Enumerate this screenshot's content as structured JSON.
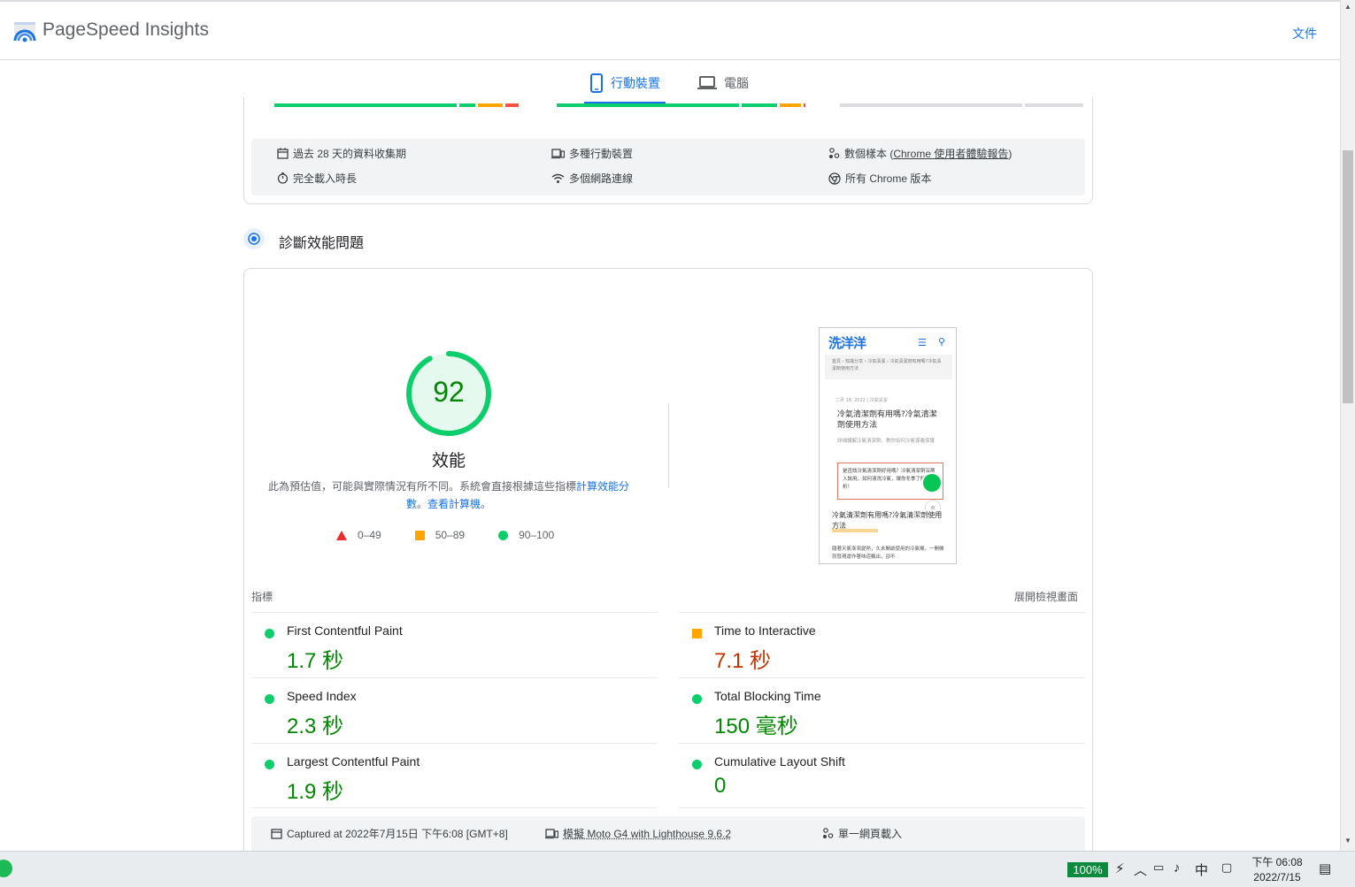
{
  "header": {
    "brand": "PageSpeed Insights",
    "docs_link": "文件"
  },
  "tabs": [
    {
      "label": "行動裝置",
      "active": true
    },
    {
      "label": "電腦",
      "active": false
    }
  ],
  "field_info": {
    "collection_period": "過去 28 天的資料收集期",
    "devices": "多種行動裝置",
    "samples_prefix": "數個樣本 (",
    "samples_link": "Chrome 使用者體驗報告",
    "samples_suffix": ")",
    "full_load": "完全載入時長",
    "network": "多個網路連線",
    "chrome_versions": "所有 Chrome 版本"
  },
  "diagnose": {
    "title": "診斷效能問題"
  },
  "gauge": {
    "score": "92",
    "score_fraction": 0.92,
    "label": "效能"
  },
  "note": {
    "text": "此為預估值，可能與實際情況有所不同。系統會直接根據這些指標",
    "link1": "計算效能分數",
    "sep": "。",
    "link2": "查看計算機",
    "end": "。"
  },
  "legend": {
    "fail": "0–49",
    "average": "50–89",
    "pass": "90–100"
  },
  "phone": {
    "logo": "洗洋洋",
    "breadcrumb": "首頁 › 知識分享 › 冷氣清潔 › 冷氣清潔劑有用嗎?冷氣清潔劑使用方法",
    "date": "二月 18, 2022 | 冷氣清潔",
    "title": "冷氣清潔劑有用嗎?冷氣清潔劑使用方法",
    "subtitle": "詳細講解冷氣清潔劑，教你如何冷氣保養保護",
    "box_text": "是否該冷氣清潔劑好用嗎？冷氣清潔劑深層入該用，如何清洗冷氣，讓你冬季了解分析！",
    "heading2": "冷氣清潔劑有用嗎?冷氣清潔劑使用方法",
    "paragraph": "隨著天氣漸漸變熱，久未開啟使用的冷氣機，一開機就發現運作著味道飄出，卻不"
  },
  "metrics_header": {
    "left": "指標",
    "right": "展開檢視畫面"
  },
  "metrics": [
    {
      "name": "First Contentful Paint",
      "value": "1.7 秒",
      "status": "pass"
    },
    {
      "name": "Time to Interactive",
      "value": "7.1 秒",
      "status": "average"
    },
    {
      "name": "Speed Index",
      "value": "2.3 秒",
      "status": "pass"
    },
    {
      "name": "Total Blocking Time",
      "value": "150 毫秒",
      "status": "pass"
    },
    {
      "name": "Largest Contentful Paint",
      "value": "1.9 秒",
      "status": "pass"
    },
    {
      "name": "Cumulative Layout Shift",
      "value": "0",
      "status": "pass"
    }
  ],
  "run_info": {
    "captured": "Captured at 2022年7月15日 下午6:08 [GMT+8]",
    "device": "模擬 Moto G4 with Lighthouse 9.6.2",
    "load": "單一網頁載入"
  },
  "taskbar": {
    "battery": "100%",
    "ime": "中",
    "time": "下午 06:08",
    "date": "2022/7/15"
  },
  "colors": {
    "pass": "#0cce6b",
    "average": "#ffa400",
    "fail": "#ff4e42",
    "accent": "#1a73e8"
  }
}
